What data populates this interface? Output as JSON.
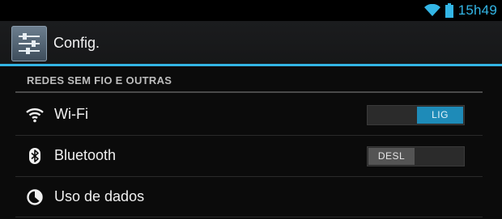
{
  "status_bar": {
    "time": "15h49",
    "accent_color": "#33b5e5",
    "icons": [
      "wifi-signal-icon",
      "battery-icon"
    ]
  },
  "action_bar": {
    "app_icon": "settings-sliders-icon",
    "title": "Config."
  },
  "section": {
    "header": "REDES SEM FIO E OUTRAS"
  },
  "settings": [
    {
      "icon": "wifi-icon",
      "label": "Wi-Fi",
      "toggle": {
        "state": "on",
        "label": "LIG"
      }
    },
    {
      "icon": "bluetooth-icon",
      "label": "Bluetooth",
      "toggle": {
        "state": "off",
        "label": "DESL"
      }
    },
    {
      "icon": "data-usage-icon",
      "label": "Uso de dados"
    }
  ]
}
